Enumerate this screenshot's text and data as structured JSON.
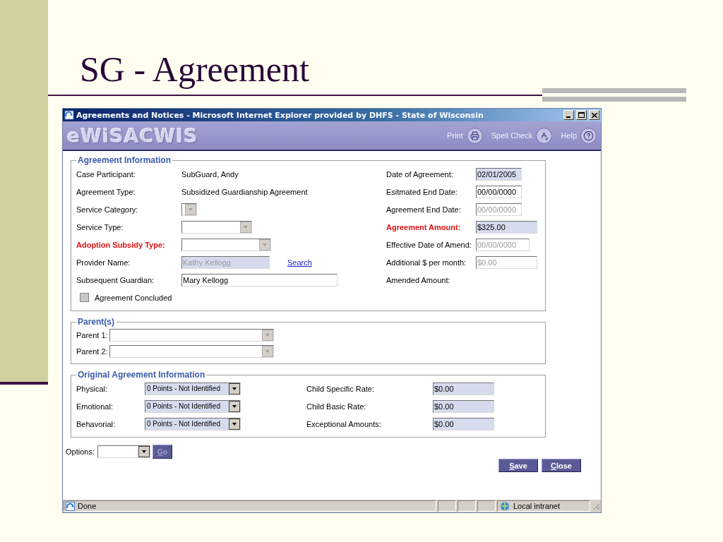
{
  "slide": {
    "title": "SG - Agreement"
  },
  "window": {
    "title": "Agreements and Notices - Microsoft Internet Explorer provided by DHFS - State of Wisconsin"
  },
  "header": {
    "logo": "eWiSACWIS",
    "actions": [
      {
        "label": "Print",
        "kind": "print"
      },
      {
        "label": "Spell Check",
        "kind": "spell"
      },
      {
        "label": "Help",
        "kind": "help"
      }
    ]
  },
  "agreement_information": {
    "legend": "Agreement Information",
    "left_rows": [
      {
        "label": "Case Participant:",
        "required": false,
        "kind": "text",
        "value": "SubGuard, Andy"
      },
      {
        "label": "Agreement Type:",
        "required": false,
        "kind": "text",
        "value": "Subsidized Guardianship Agreement"
      },
      {
        "label": "Service Category:",
        "required": false,
        "kind": "select",
        "disabled": true
      },
      {
        "label": "Service Type:",
        "required": false,
        "kind": "select",
        "disabled": true
      },
      {
        "label": "Adoption Subsidy Type:",
        "required": true,
        "kind": "select",
        "disabled": true
      },
      {
        "label": "Provider Name:",
        "required": false,
        "kind": "field",
        "value": "Kathy Kellogg",
        "shaded": true,
        "disabled": true,
        "link": "Search"
      },
      {
        "label": "Subsequent Guardian:",
        "required": false,
        "kind": "field",
        "value": "Mary Kellogg",
        "shaded": false,
        "disabled": false
      }
    ],
    "right_rows": [
      {
        "label": "Date of Agreement:",
        "required": false,
        "kind": "field",
        "value": "02/01/2005",
        "shaded": true,
        "disabled": false
      },
      {
        "label": "Esitmated End Date:",
        "required": false,
        "kind": "field",
        "value": "00/00/0000",
        "shaded": false,
        "disabled": false
      },
      {
        "label": "Agreement End Date:",
        "required": false,
        "kind": "field",
        "value": "00/00/0000",
        "shaded": false,
        "disabled": true
      },
      {
        "label": "Agreement Amount:",
        "required": true,
        "kind": "field",
        "value": "$325.00",
        "shaded": true,
        "disabled": false
      },
      {
        "label": "Effective Date of Amend:",
        "required": false,
        "kind": "field",
        "value": "00/00/0000",
        "shaded": false,
        "disabled": true
      },
      {
        "label": "Additional $ per month:",
        "required": false,
        "kind": "field",
        "value": "$0.00",
        "shaded": false,
        "disabled": true
      },
      {
        "label": "Amended Amount:",
        "required": false,
        "kind": "none"
      }
    ],
    "agreement_concluded": {
      "label": "Agreement Concluded",
      "checked": false,
      "disabled": true
    }
  },
  "parents": {
    "legend": "Parent(s)",
    "rows": [
      {
        "label": "Parent 1:",
        "disabled": true
      },
      {
        "label": "Parent 2:",
        "disabled": true
      }
    ]
  },
  "original_agreement_information": {
    "legend": "Original Agreement Information",
    "rows": [
      {
        "label": "Physical:",
        "value": "0 Points - Not Identified",
        "rate_label": "Child Specific Rate:",
        "rate_value": "$0.00"
      },
      {
        "label": "Emotional:",
        "value": "0 Points - Not Identified",
        "rate_label": "Child Basic Rate:",
        "rate_value": "$0.00"
      },
      {
        "label": "Behavorial:",
        "value": "0 Points - Not Identified",
        "rate_label": "Exceptional Amounts:",
        "rate_value": "$0.00"
      }
    ]
  },
  "options": {
    "label": "Options:",
    "go": "Go"
  },
  "buttons": [
    {
      "label": "Save"
    },
    {
      "label": "Close"
    }
  ],
  "status_bar": {
    "text": "Done",
    "zone": "Local intranet"
  }
}
